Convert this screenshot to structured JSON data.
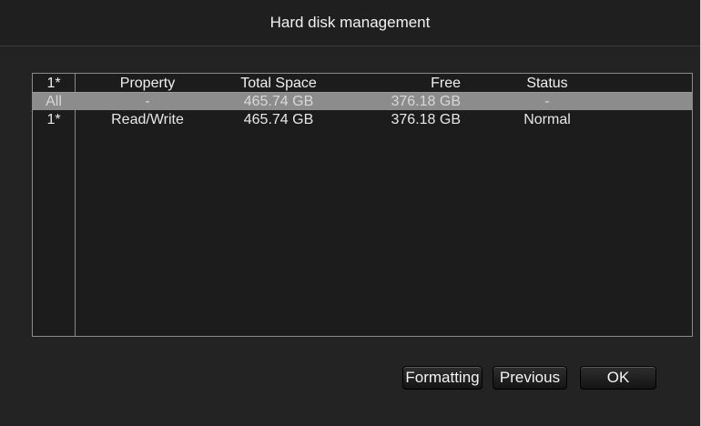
{
  "window": {
    "title": "Hard disk management"
  },
  "table": {
    "headers": {
      "id": "1*",
      "property": "Property",
      "total": "Total Space",
      "free": "Free",
      "status": "Status"
    },
    "rows": [
      {
        "id": "All",
        "property": "-",
        "total": "465.74 GB",
        "free": "376.18 GB",
        "status": "-"
      },
      {
        "id": "1*",
        "property": "Read/Write",
        "total": "465.74 GB",
        "free": "376.18 GB",
        "status": "Normal"
      }
    ]
  },
  "buttons": {
    "formatting": "Formatting",
    "previous": "Previous",
    "ok": "OK"
  }
}
